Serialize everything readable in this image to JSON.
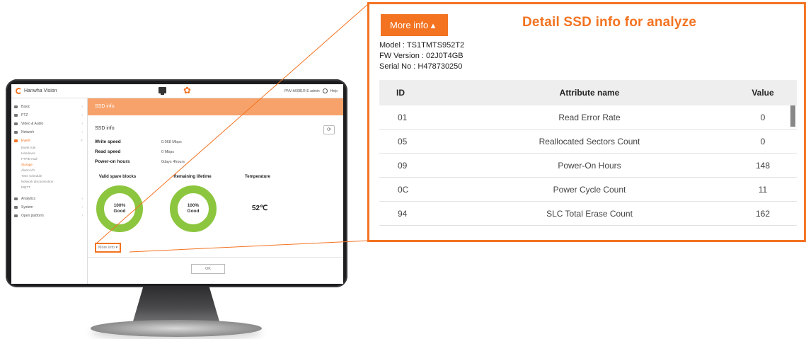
{
  "screen": {
    "brand": "Hanwha Vision",
    "header_user": "PNV-A6081R-E  admin",
    "header_help": "Help",
    "sidebar": [
      {
        "label": "Basic",
        "active": false
      },
      {
        "label": "PTZ",
        "active": false
      },
      {
        "label": "Video & Audio",
        "active": false
      },
      {
        "label": "Network",
        "active": false
      },
      {
        "label": "Event",
        "active": true
      }
    ],
    "sidebar_sub": [
      {
        "label": "Event rule",
        "active": false
      },
      {
        "label": "Handover",
        "active": false
      },
      {
        "label": "FTP/E-mail",
        "active": false
      },
      {
        "label": "Storage",
        "active": true
      },
      {
        "label": "Alarm I/O",
        "active": false
      },
      {
        "label": "Time schedule",
        "active": false
      },
      {
        "label": "Network disconnection",
        "active": false
      },
      {
        "label": "MQTT",
        "active": false
      }
    ],
    "sidebar_bottom": [
      {
        "label": "Analytics"
      },
      {
        "label": "System"
      },
      {
        "label": "Open platform"
      }
    ],
    "page_title": "SSD info",
    "section_title": "SSD info",
    "refresh_symbol": "⟳",
    "rows": [
      {
        "key": "Write speed",
        "value": "0.068 Mbps"
      },
      {
        "key": "Read speed",
        "value": "0 Mbps"
      },
      {
        "key": "Power-on hours",
        "value": "0days 4hours"
      }
    ],
    "gauge_labels": [
      "Valid spare blocks",
      "Remaining lifetime",
      "Temperature"
    ],
    "gauges": [
      {
        "percent": "100%",
        "status": "Good"
      },
      {
        "percent": "100%",
        "status": "Good"
      }
    ],
    "temperature": "52℃",
    "more_info_label": "More info ▾",
    "ok_label": "OK"
  },
  "detail": {
    "more_info_label": "More info ▴",
    "heading": "Detail SSD info for analyze",
    "model": "Model : TS1TMTS952T2",
    "fw_version": "FW Version : 02J0T4GB",
    "serial": "Serial No : H478730250",
    "table": {
      "columns": [
        "ID",
        "Attribute name",
        "Value"
      ],
      "rows": [
        {
          "id": "01",
          "name": "Read Error Rate",
          "value": "0"
        },
        {
          "id": "05",
          "name": "Reallocated Sectors Count",
          "value": "0"
        },
        {
          "id": "09",
          "name": "Power-On Hours",
          "value": "148"
        },
        {
          "id": "0C",
          "name": "Power Cycle Count",
          "value": "11"
        },
        {
          "id": "94",
          "name": "SLC Total Erase Count",
          "value": "162"
        }
      ]
    }
  },
  "colors": {
    "accent": "#f37321",
    "gauge_good": "#8cc63f",
    "title_bar": "#f6a26a"
  }
}
